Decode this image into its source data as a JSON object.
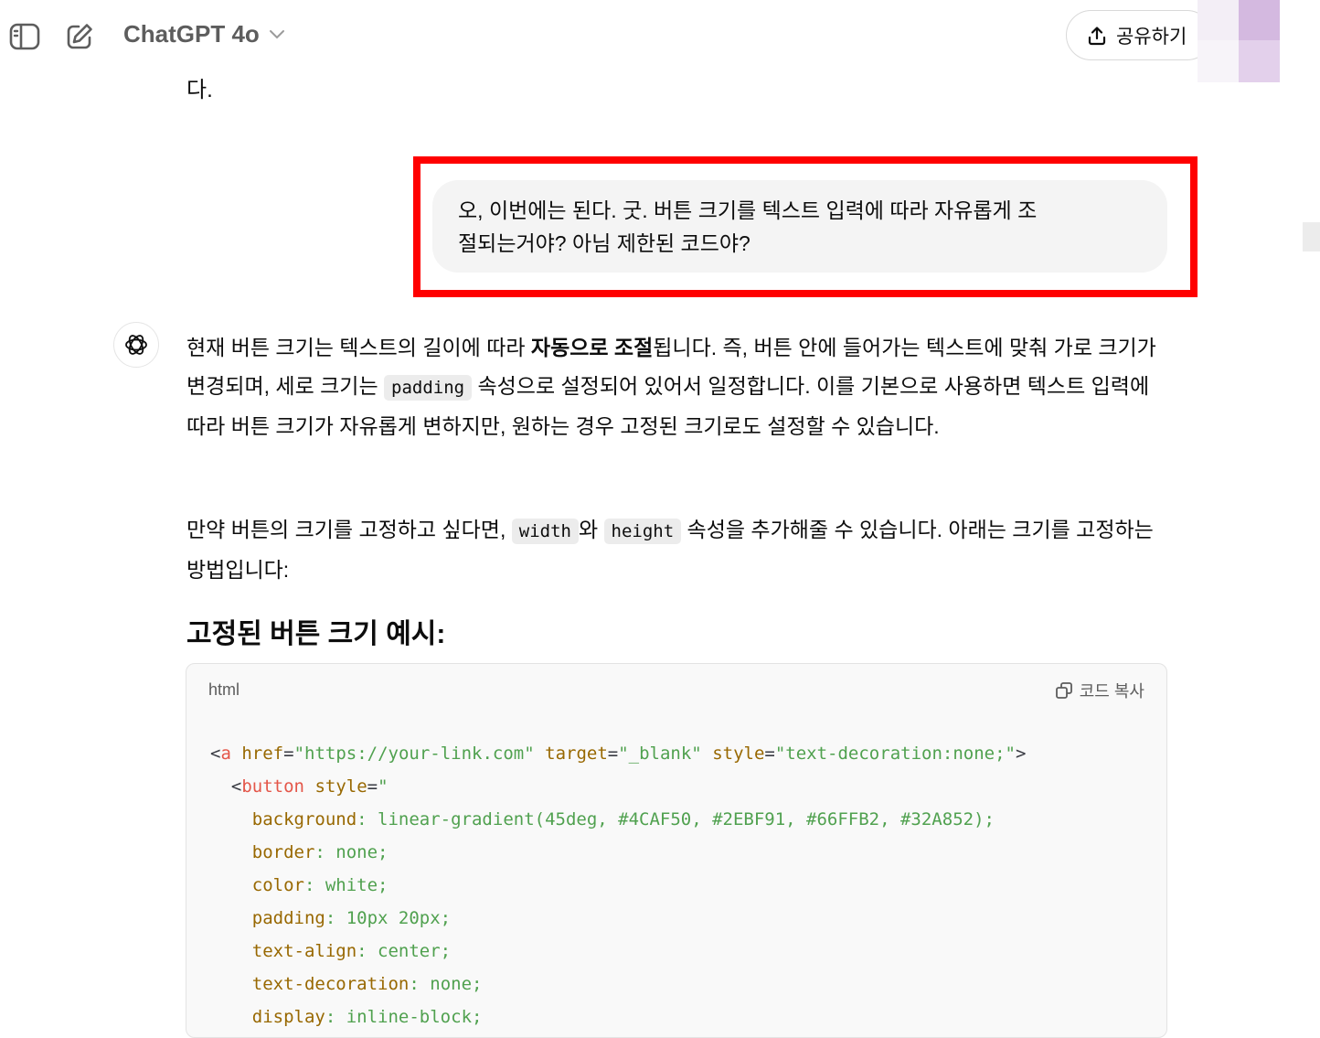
{
  "header": {
    "model_name": "ChatGPT 4o",
    "share_label": "공유하기"
  },
  "conversation": {
    "previous_tail": "다.",
    "user_message": {
      "line1": "오, 이번에는 된다. 굿. 버튼 크기를 텍스트 입력에 따라 자유롭게 조",
      "line2": "절되는거야? 아님 제한된 코드야?"
    },
    "assistant": {
      "p1_a": "현재 버튼 크기는 텍스트의 길이에 따라 ",
      "p1_bold": "자동으로 조절",
      "p1_b": "됩니다. 즉, 버튼 안에 들어가는 텍스트에 맞춰 가로 크기가 변경되며, 세로 크기는 ",
      "p1_code": "padding",
      "p1_c": " 속성으로 설정되어 있어서 일정합니다. 이를 기본으로 사용하면 텍스트 입력에 따라 버튼 크기가 자유롭게 변하지만, 원하는 경우 고정된 크기로도 설정할 수 있습니다.",
      "p2_a": "만약 버튼의 크기를 고정하고 싶다면, ",
      "p2_code1": "width",
      "p2_b": "와 ",
      "p2_code2": "height",
      "p2_c": " 속성을 추가해줄 수 있습니다. 아래는 크기를 고정하는 방법입니다:",
      "heading": "고정된 버튼 크기 예시:",
      "code_lang": "html",
      "copy_label": "코드 복사",
      "code": {
        "l1_tag": "a",
        "l1_attr1": "href",
        "l1_val1": "\"https://your-link.com\"",
        "l1_attr2": "target",
        "l1_val2": "\"_blank\"",
        "l1_attr3": "style",
        "l1_val3": "\"text-decoration:none;\"",
        "l2_tag": "button",
        "l2_attr": "style",
        "l2_open": "\"",
        "props": [
          {
            "name": "background",
            "value": "linear-gradient(45deg, #4CAF50, #2EBF91, #66FFB2, #32A852);"
          },
          {
            "name": "border",
            "value": "none;"
          },
          {
            "name": "color",
            "value": "white;"
          },
          {
            "name": "padding",
            "value": "10px 20px;"
          },
          {
            "name": "text-align",
            "value": "center;"
          },
          {
            "name": "text-decoration",
            "value": "none;"
          },
          {
            "name": "display",
            "value": "inline-block;"
          }
        ]
      }
    }
  },
  "colors": {
    "highlight_border": "#ff0000",
    "user_bubble_bg": "#f4f4f4",
    "code_tag": "#e45649",
    "code_attr": "#986801",
    "code_string": "#50a14f"
  },
  "icons": [
    "sidebar-toggle-icon",
    "new-chat-icon",
    "chevron-down-icon",
    "share-icon",
    "openai-logo-icon",
    "copy-icon"
  ]
}
